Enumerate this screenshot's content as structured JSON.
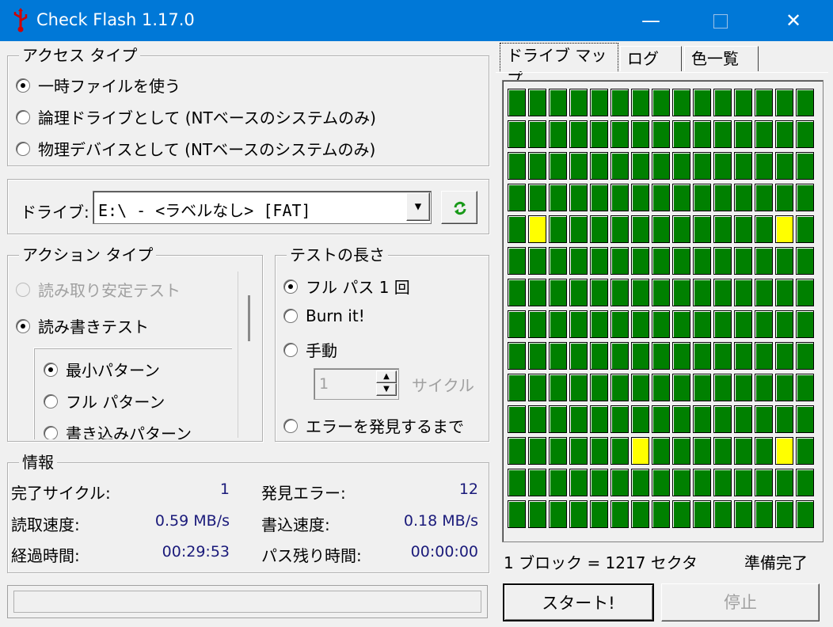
{
  "window": {
    "title": "Check Flash 1.17.0",
    "minimize": "—",
    "close": "✕"
  },
  "access_type": {
    "legend": "アクセス タイプ",
    "options": [
      {
        "label": "一時ファイルを使う",
        "selected": true
      },
      {
        "label": "論理ドライブとして (NTベースのシステムのみ)",
        "selected": false
      },
      {
        "label": "物理デバイスとして (NTベースのシステムのみ)",
        "selected": false
      }
    ]
  },
  "drive": {
    "label": "ドライブ:",
    "value": "E:\\ - <ラベルなし> [FAT]",
    "refresh_icon": "refresh-icon"
  },
  "action_type": {
    "legend": "アクション タイプ",
    "options": [
      {
        "label": "読み取り安定テスト",
        "selected": false,
        "disabled": true
      },
      {
        "label": "読み書きテスト",
        "selected": true,
        "disabled": false
      }
    ],
    "patterns": [
      {
        "label": "最小パターン",
        "selected": true
      },
      {
        "label": "フル パターン",
        "selected": false
      },
      {
        "label": "書き込みパターン",
        "selected": false
      }
    ]
  },
  "test_length": {
    "legend": "テストの長さ",
    "options": [
      {
        "label": "フル パス 1 回",
        "selected": true
      },
      {
        "label": "Burn it!",
        "selected": false
      },
      {
        "label": "手動",
        "selected": false
      },
      {
        "label": "エラーを発見するまで",
        "selected": false
      }
    ],
    "cycles_value": "1",
    "cycles_label": "サイクル"
  },
  "info": {
    "legend": "情報",
    "completed_cycles_label": "完了サイクル:",
    "completed_cycles_value": "1",
    "errors_label": "発見エラー:",
    "errors_value": "12",
    "read_speed_label": "読取速度:",
    "read_speed_value": "0.59 MB/s",
    "write_speed_label": "書込速度:",
    "write_speed_value": "0.18 MB/s",
    "elapsed_label": "経過時間:",
    "elapsed_value": "00:29:53",
    "remaining_label": "パス残り時間:",
    "remaining_value": "00:00:00"
  },
  "tabs": [
    {
      "label": "ドライブ マップ",
      "active": true
    },
    {
      "label": "ログ",
      "active": false
    },
    {
      "label": "色一覧",
      "active": false
    }
  ],
  "drive_map": {
    "columns": 15,
    "rows": 14,
    "good_color": "#008000",
    "bad_color": "#ffff00",
    "bad_cells": [
      [
        4,
        1
      ],
      [
        4,
        13
      ],
      [
        11,
        6
      ],
      [
        11,
        13
      ]
    ]
  },
  "status": {
    "block_info": "1 ブロック = 1217 セクタ",
    "state": "準備完了"
  },
  "buttons": {
    "start": "スタート!",
    "stop": "停止"
  },
  "progress": 0
}
